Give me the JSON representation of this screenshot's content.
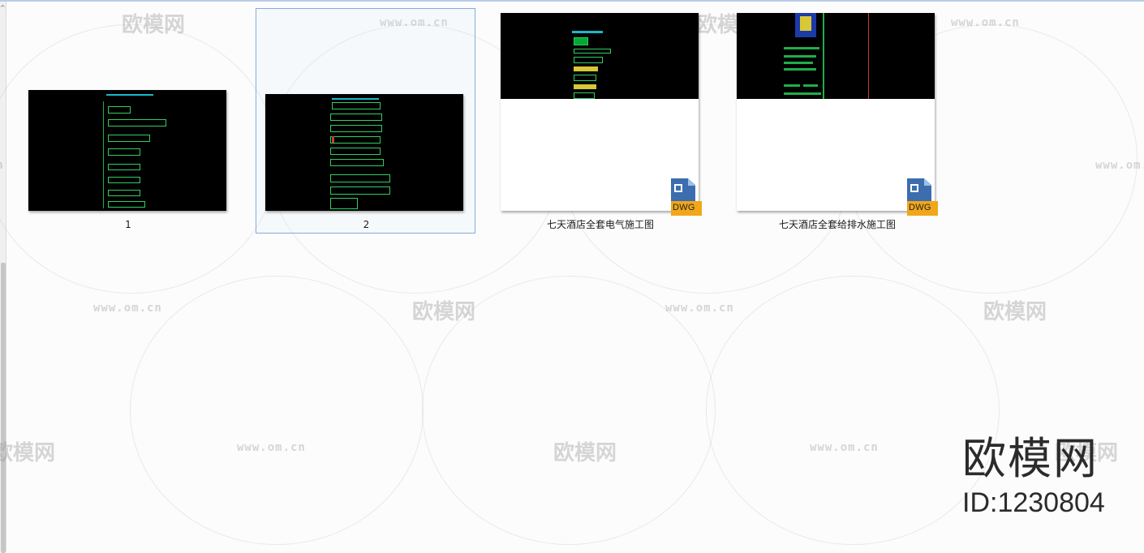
{
  "files": [
    {
      "name": "1",
      "type": "image",
      "selected": false
    },
    {
      "name": "2",
      "type": "image",
      "selected": true
    },
    {
      "name": "七天酒店全套电气施工图",
      "type": "dwg",
      "badge": "DWG",
      "selected": false
    },
    {
      "name": "七天酒店全套给排水施工图",
      "type": "dwg",
      "badge": "DWG",
      "selected": false
    }
  ],
  "watermark": {
    "url": "www.om.cn",
    "brand": "欧模网"
  },
  "branding": {
    "name": "欧模网",
    "id_text": "ID:1230804"
  },
  "colors": {
    "selection_border": "#84acdd",
    "dwg_blue": "#3c6eaf",
    "dwg_orange": "#f2a619"
  }
}
